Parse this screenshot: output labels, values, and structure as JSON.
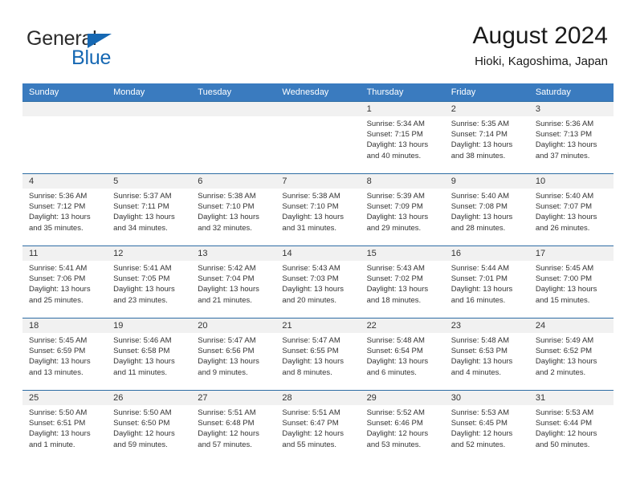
{
  "brand": {
    "name_part1": "General",
    "name_part2": "Blue"
  },
  "header": {
    "title": "August 2024",
    "subtitle": "Hioki, Kagoshima, Japan"
  },
  "weekdays": [
    "Sunday",
    "Monday",
    "Tuesday",
    "Wednesday",
    "Thursday",
    "Friday",
    "Saturday"
  ],
  "colors": {
    "header_blue": "#3a7bbf",
    "row_divider_blue": "#2e6da4",
    "daynum_band": "#f1f1f1",
    "brand_blue": "#1668b3",
    "text": "#333333"
  },
  "weeks": [
    [
      {
        "day": "",
        "sunrise": "",
        "sunset": "",
        "daylight1": "",
        "daylight2": ""
      },
      {
        "day": "",
        "sunrise": "",
        "sunset": "",
        "daylight1": "",
        "daylight2": ""
      },
      {
        "day": "",
        "sunrise": "",
        "sunset": "",
        "daylight1": "",
        "daylight2": ""
      },
      {
        "day": "",
        "sunrise": "",
        "sunset": "",
        "daylight1": "",
        "daylight2": ""
      },
      {
        "day": "1",
        "sunrise": "Sunrise: 5:34 AM",
        "sunset": "Sunset: 7:15 PM",
        "daylight1": "Daylight: 13 hours",
        "daylight2": "and 40 minutes."
      },
      {
        "day": "2",
        "sunrise": "Sunrise: 5:35 AM",
        "sunset": "Sunset: 7:14 PM",
        "daylight1": "Daylight: 13 hours",
        "daylight2": "and 38 minutes."
      },
      {
        "day": "3",
        "sunrise": "Sunrise: 5:36 AM",
        "sunset": "Sunset: 7:13 PM",
        "daylight1": "Daylight: 13 hours",
        "daylight2": "and 37 minutes."
      }
    ],
    [
      {
        "day": "4",
        "sunrise": "Sunrise: 5:36 AM",
        "sunset": "Sunset: 7:12 PM",
        "daylight1": "Daylight: 13 hours",
        "daylight2": "and 35 minutes."
      },
      {
        "day": "5",
        "sunrise": "Sunrise: 5:37 AM",
        "sunset": "Sunset: 7:11 PM",
        "daylight1": "Daylight: 13 hours",
        "daylight2": "and 34 minutes."
      },
      {
        "day": "6",
        "sunrise": "Sunrise: 5:38 AM",
        "sunset": "Sunset: 7:10 PM",
        "daylight1": "Daylight: 13 hours",
        "daylight2": "and 32 minutes."
      },
      {
        "day": "7",
        "sunrise": "Sunrise: 5:38 AM",
        "sunset": "Sunset: 7:10 PM",
        "daylight1": "Daylight: 13 hours",
        "daylight2": "and 31 minutes."
      },
      {
        "day": "8",
        "sunrise": "Sunrise: 5:39 AM",
        "sunset": "Sunset: 7:09 PM",
        "daylight1": "Daylight: 13 hours",
        "daylight2": "and 29 minutes."
      },
      {
        "day": "9",
        "sunrise": "Sunrise: 5:40 AM",
        "sunset": "Sunset: 7:08 PM",
        "daylight1": "Daylight: 13 hours",
        "daylight2": "and 28 minutes."
      },
      {
        "day": "10",
        "sunrise": "Sunrise: 5:40 AM",
        "sunset": "Sunset: 7:07 PM",
        "daylight1": "Daylight: 13 hours",
        "daylight2": "and 26 minutes."
      }
    ],
    [
      {
        "day": "11",
        "sunrise": "Sunrise: 5:41 AM",
        "sunset": "Sunset: 7:06 PM",
        "daylight1": "Daylight: 13 hours",
        "daylight2": "and 25 minutes."
      },
      {
        "day": "12",
        "sunrise": "Sunrise: 5:41 AM",
        "sunset": "Sunset: 7:05 PM",
        "daylight1": "Daylight: 13 hours",
        "daylight2": "and 23 minutes."
      },
      {
        "day": "13",
        "sunrise": "Sunrise: 5:42 AM",
        "sunset": "Sunset: 7:04 PM",
        "daylight1": "Daylight: 13 hours",
        "daylight2": "and 21 minutes."
      },
      {
        "day": "14",
        "sunrise": "Sunrise: 5:43 AM",
        "sunset": "Sunset: 7:03 PM",
        "daylight1": "Daylight: 13 hours",
        "daylight2": "and 20 minutes."
      },
      {
        "day": "15",
        "sunrise": "Sunrise: 5:43 AM",
        "sunset": "Sunset: 7:02 PM",
        "daylight1": "Daylight: 13 hours",
        "daylight2": "and 18 minutes."
      },
      {
        "day": "16",
        "sunrise": "Sunrise: 5:44 AM",
        "sunset": "Sunset: 7:01 PM",
        "daylight1": "Daylight: 13 hours",
        "daylight2": "and 16 minutes."
      },
      {
        "day": "17",
        "sunrise": "Sunrise: 5:45 AM",
        "sunset": "Sunset: 7:00 PM",
        "daylight1": "Daylight: 13 hours",
        "daylight2": "and 15 minutes."
      }
    ],
    [
      {
        "day": "18",
        "sunrise": "Sunrise: 5:45 AM",
        "sunset": "Sunset: 6:59 PM",
        "daylight1": "Daylight: 13 hours",
        "daylight2": "and 13 minutes."
      },
      {
        "day": "19",
        "sunrise": "Sunrise: 5:46 AM",
        "sunset": "Sunset: 6:58 PM",
        "daylight1": "Daylight: 13 hours",
        "daylight2": "and 11 minutes."
      },
      {
        "day": "20",
        "sunrise": "Sunrise: 5:47 AM",
        "sunset": "Sunset: 6:56 PM",
        "daylight1": "Daylight: 13 hours",
        "daylight2": "and 9 minutes."
      },
      {
        "day": "21",
        "sunrise": "Sunrise: 5:47 AM",
        "sunset": "Sunset: 6:55 PM",
        "daylight1": "Daylight: 13 hours",
        "daylight2": "and 8 minutes."
      },
      {
        "day": "22",
        "sunrise": "Sunrise: 5:48 AM",
        "sunset": "Sunset: 6:54 PM",
        "daylight1": "Daylight: 13 hours",
        "daylight2": "and 6 minutes."
      },
      {
        "day": "23",
        "sunrise": "Sunrise: 5:48 AM",
        "sunset": "Sunset: 6:53 PM",
        "daylight1": "Daylight: 13 hours",
        "daylight2": "and 4 minutes."
      },
      {
        "day": "24",
        "sunrise": "Sunrise: 5:49 AM",
        "sunset": "Sunset: 6:52 PM",
        "daylight1": "Daylight: 13 hours",
        "daylight2": "and 2 minutes."
      }
    ],
    [
      {
        "day": "25",
        "sunrise": "Sunrise: 5:50 AM",
        "sunset": "Sunset: 6:51 PM",
        "daylight1": "Daylight: 13 hours",
        "daylight2": "and 1 minute."
      },
      {
        "day": "26",
        "sunrise": "Sunrise: 5:50 AM",
        "sunset": "Sunset: 6:50 PM",
        "daylight1": "Daylight: 12 hours",
        "daylight2": "and 59 minutes."
      },
      {
        "day": "27",
        "sunrise": "Sunrise: 5:51 AM",
        "sunset": "Sunset: 6:48 PM",
        "daylight1": "Daylight: 12 hours",
        "daylight2": "and 57 minutes."
      },
      {
        "day": "28",
        "sunrise": "Sunrise: 5:51 AM",
        "sunset": "Sunset: 6:47 PM",
        "daylight1": "Daylight: 12 hours",
        "daylight2": "and 55 minutes."
      },
      {
        "day": "29",
        "sunrise": "Sunrise: 5:52 AM",
        "sunset": "Sunset: 6:46 PM",
        "daylight1": "Daylight: 12 hours",
        "daylight2": "and 53 minutes."
      },
      {
        "day": "30",
        "sunrise": "Sunrise: 5:53 AM",
        "sunset": "Sunset: 6:45 PM",
        "daylight1": "Daylight: 12 hours",
        "daylight2": "and 52 minutes."
      },
      {
        "day": "31",
        "sunrise": "Sunrise: 5:53 AM",
        "sunset": "Sunset: 6:44 PM",
        "daylight1": "Daylight: 12 hours",
        "daylight2": "and 50 minutes."
      }
    ]
  ]
}
